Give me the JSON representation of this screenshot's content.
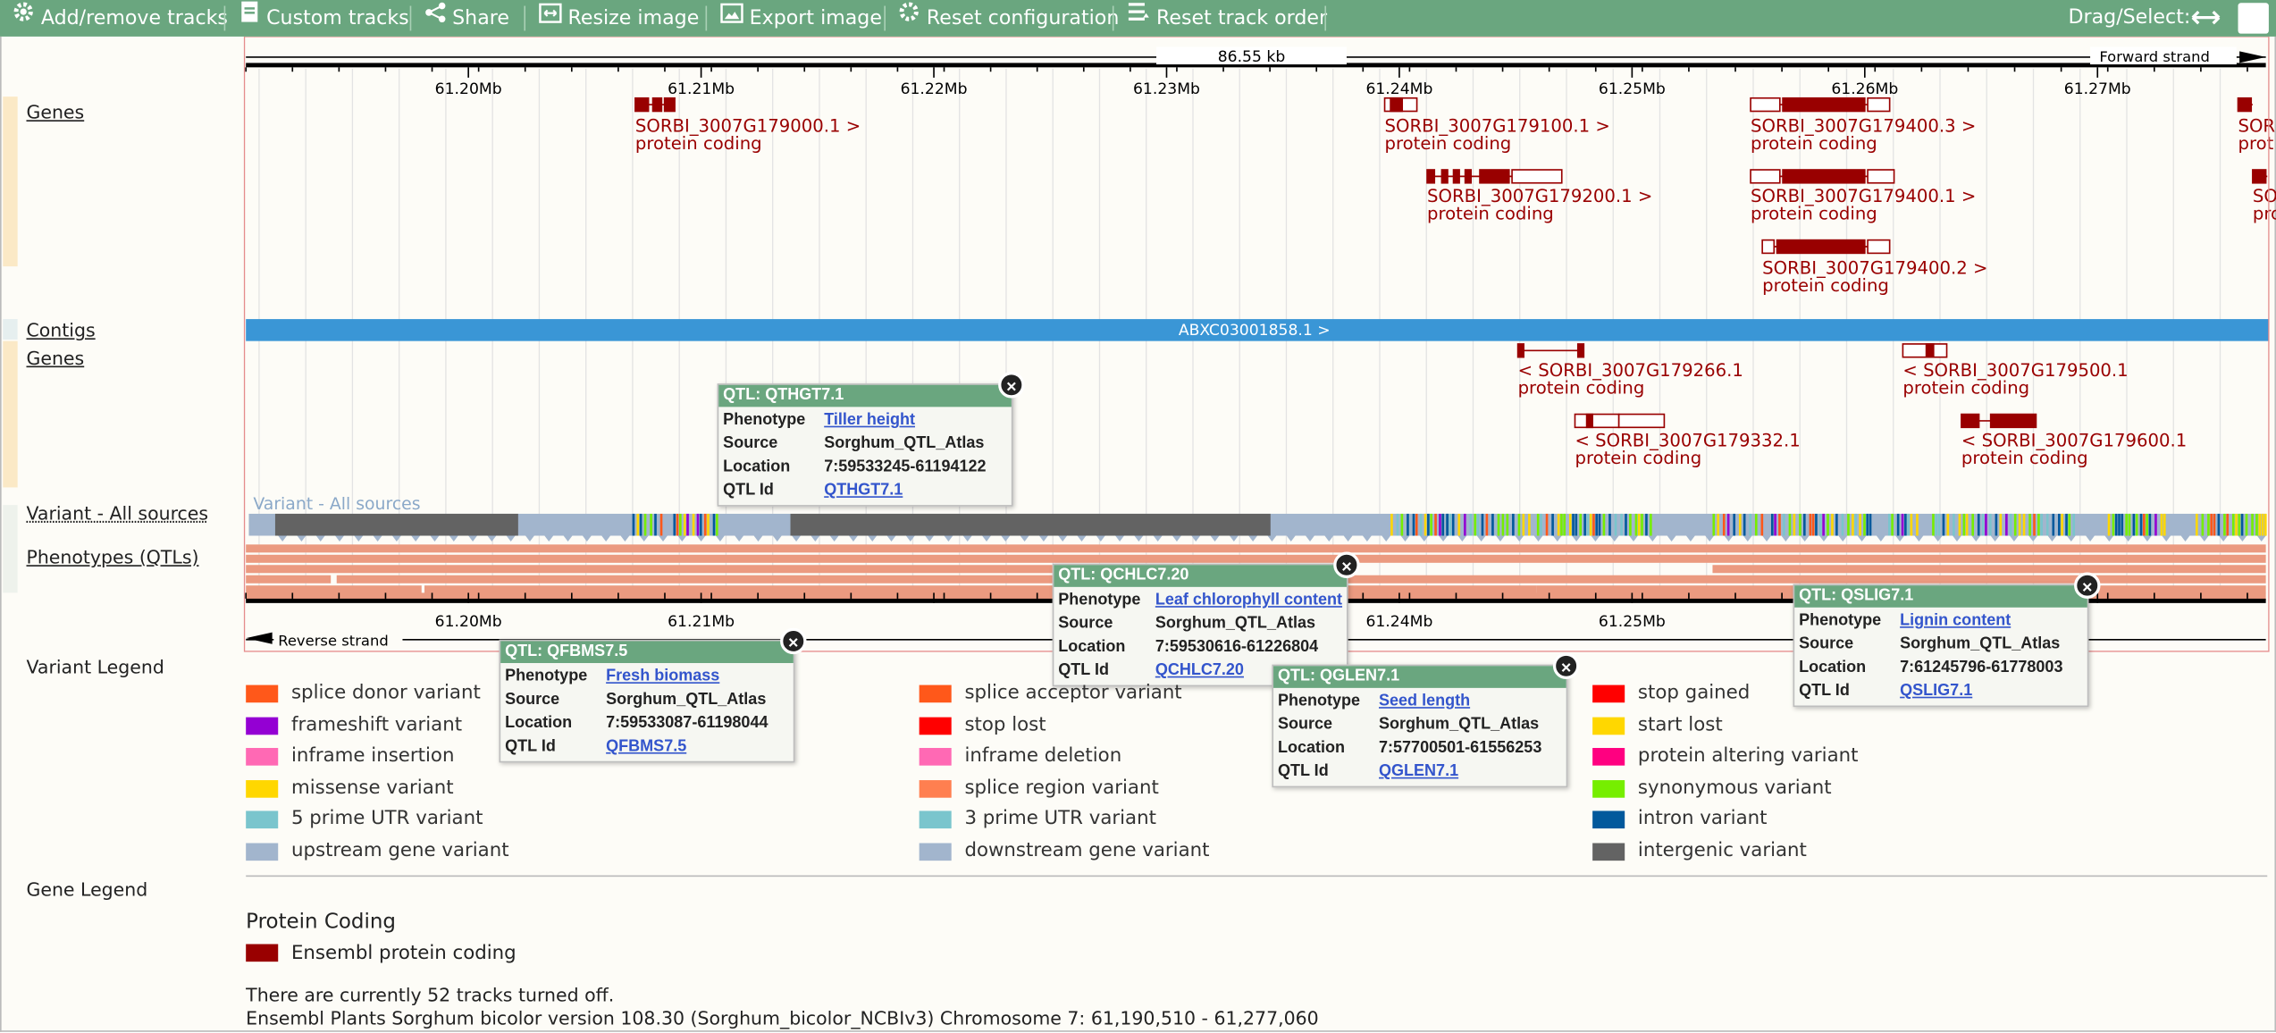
{
  "toolbar": {
    "add_remove": "Add/remove tracks",
    "custom": "Custom tracks",
    "share": "Share",
    "resize": "Resize image",
    "export": "Export image",
    "reset_config": "Reset configuration",
    "reset_order": "Reset track order",
    "drag_select": "Drag/Select:"
  },
  "ruler": {
    "span": "86.55 kb",
    "forward": "Forward strand",
    "reverse": "Reverse strand",
    "ticks": [
      "61.20Mb",
      "61.21Mb",
      "61.22Mb",
      "61.23Mb",
      "61.24Mb",
      "61.25Mb",
      "61.26Mb",
      "61.27Mb"
    ]
  },
  "tracks": {
    "genes": "Genes",
    "contigs": "Contigs",
    "genes2": "Genes",
    "variant": "Variant - All sources",
    "variant_inner": "Variant - All sources",
    "phenotypes": "Phenotypes (QTLs)",
    "contig_name": "ABXC03001858.1 >"
  },
  "genes_forward": [
    {
      "name": "SORBI_3007G179000.1 >",
      "biotype": "protein coding"
    },
    {
      "name": "SORBI_3007G179100.1 >",
      "biotype": "protein coding"
    },
    {
      "name": "SORBI_3007G179200.1 >",
      "biotype": "protein coding"
    },
    {
      "name": "SORBI_3007G179400.3 >",
      "biotype": "protein coding"
    },
    {
      "name": "SORBI_3007G179400.1 >",
      "biotype": "protein coding"
    },
    {
      "name": "SORBI_3007G179400.2 >",
      "biotype": "protein coding"
    },
    {
      "name": "SOR",
      "biotype": "prot"
    },
    {
      "name": "SO",
      "biotype": "pro"
    }
  ],
  "genes_reverse": [
    {
      "name": "< SORBI_3007G179266.1",
      "biotype": "protein coding"
    },
    {
      "name": "< SORBI_3007G179500.1",
      "biotype": "protein coding"
    },
    {
      "name": "< SORBI_3007G179332.1",
      "biotype": "protein coding"
    },
    {
      "name": "< SORBI_3007G179600.1",
      "biotype": "protein coding"
    }
  ],
  "popups": [
    {
      "title": "QTL: QTHGT7.1",
      "phenotype": "Tiller height",
      "source": "Sorghum_QTL_Atlas",
      "location": "7:59533245-61194122",
      "qtl_id": "QTHGT7.1"
    },
    {
      "title": "QTL: QCHLC7.20",
      "phenotype": "Leaf chlorophyll content",
      "source": "Sorghum_QTL_Atlas",
      "location": "7:59530616-61226804",
      "qtl_id": "QCHLC7.20"
    },
    {
      "title": "QTL: QSLIG7.1",
      "phenotype": "Lignin content",
      "source": "Sorghum_QTL_Atlas",
      "location": "7:61245796-61778003",
      "qtl_id": "QSLIG7.1"
    },
    {
      "title": "QTL: QFBMS7.5",
      "phenotype": "Fresh biomass",
      "source": "Sorghum_QTL_Atlas",
      "location": "7:59533087-61198044",
      "qtl_id": "QFBMS7.5"
    },
    {
      "title": "QTL: QGLEN7.1",
      "phenotype": "Seed length",
      "source": "Sorghum_QTL_Atlas",
      "location": "7:57700501-61556253",
      "qtl_id": "QGLEN7.1"
    }
  ],
  "popup_keys": {
    "phenotype": "Phenotype",
    "source": "Source",
    "location": "Location",
    "qtl_id": "QTL Id"
  },
  "variant_legend": {
    "title": "Variant Legend",
    "items": [
      {
        "label": "splice donor variant",
        "color": "#ff581a"
      },
      {
        "label": "splice acceptor variant",
        "color": "#ff581a"
      },
      {
        "label": "stop gained",
        "color": "#ff0000"
      },
      {
        "label": "frameshift variant",
        "color": "#9400d3"
      },
      {
        "label": "stop lost",
        "color": "#ff0000"
      },
      {
        "label": "start lost",
        "color": "#ffd700"
      },
      {
        "label": "inframe insertion",
        "color": "#ff69b4"
      },
      {
        "label": "inframe deletion",
        "color": "#ff69b4"
      },
      {
        "label": "protein altering variant",
        "color": "#ff0080"
      },
      {
        "label": "missense variant",
        "color": "#ffd700"
      },
      {
        "label": "splice region variant",
        "color": "#ff7f50"
      },
      {
        "label": "synonymous variant",
        "color": "#76ee00"
      },
      {
        "label": "5 prime UTR variant",
        "color": "#7ac5cd"
      },
      {
        "label": "3 prime UTR variant",
        "color": "#7ac5cd"
      },
      {
        "label": "intron variant",
        "color": "#02599c"
      },
      {
        "label": "upstream gene variant",
        "color": "#a2b5cd"
      },
      {
        "label": "downstream gene variant",
        "color": "#a2b5cd"
      },
      {
        "label": "intergenic variant",
        "color": "#636363"
      }
    ]
  },
  "gene_legend": {
    "title": "Gene Legend",
    "subtitle": "Protein Coding",
    "item": "Ensembl protein coding",
    "color": "#990000"
  },
  "footer": {
    "tracks_off": "There are currently 52 tracks turned off.",
    "version": "Ensembl Plants Sorghum bicolor version 108.30 (Sorghum_bicolor_NCBIv3) Chromosome 7: 61,190,510 - 61,277,060"
  },
  "colors": {
    "toolbar": "#6aa67f",
    "gene": "#990000",
    "contig": "#3a96d6",
    "qtl": "#eb9a80"
  }
}
